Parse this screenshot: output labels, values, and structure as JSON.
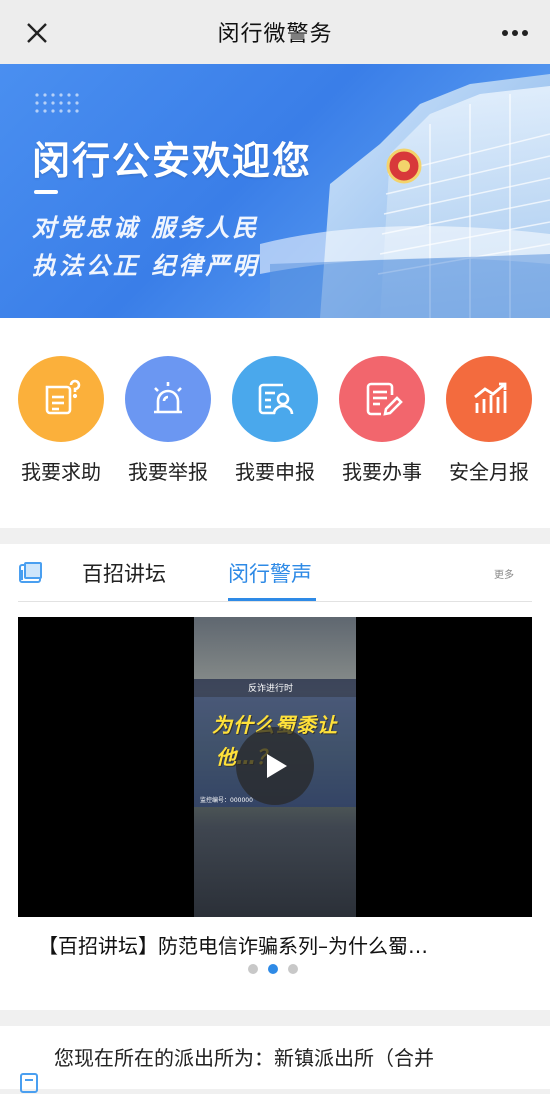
{
  "header": {
    "title": "闵行微警务"
  },
  "banner": {
    "headline": "闵行公安欢迎您",
    "slogan_line1": "对党忠诚 服务人民",
    "slogan_line2": "执法公正 纪律严明"
  },
  "quick_actions": [
    {
      "label": "我要求助",
      "icon": "help-document-icon",
      "color": "#fbb03b"
    },
    {
      "label": "我要举报",
      "icon": "alarm-siren-icon",
      "color": "#6b97f2"
    },
    {
      "label": "我要申报",
      "icon": "id-card-person-icon",
      "color": "#4aa8ec"
    },
    {
      "label": "我要办事",
      "icon": "form-edit-icon",
      "color": "#f2666d"
    },
    {
      "label": "安全月报",
      "icon": "bar-chart-trend-icon",
      "color": "#f36b3e"
    }
  ],
  "tabs": {
    "items": [
      {
        "label": "百招讲坛",
        "active": false
      },
      {
        "label": "闵行警声",
        "active": true
      }
    ],
    "more_label": "更多",
    "accent": "#2e8ae6"
  },
  "video": {
    "overlay_top": "反诈进行时",
    "overlay_line1": "为什么蜀黍让",
    "overlay_line2": "他…？",
    "overlay_footer": "监控编号：000000",
    "title": "【百招讲坛】防范电信诈骗系列–为什么蜀…"
  },
  "pager": {
    "count": 3,
    "active_index": 1
  },
  "station": {
    "text": "您现在所在的派出所为：新镇派出所（合并"
  }
}
